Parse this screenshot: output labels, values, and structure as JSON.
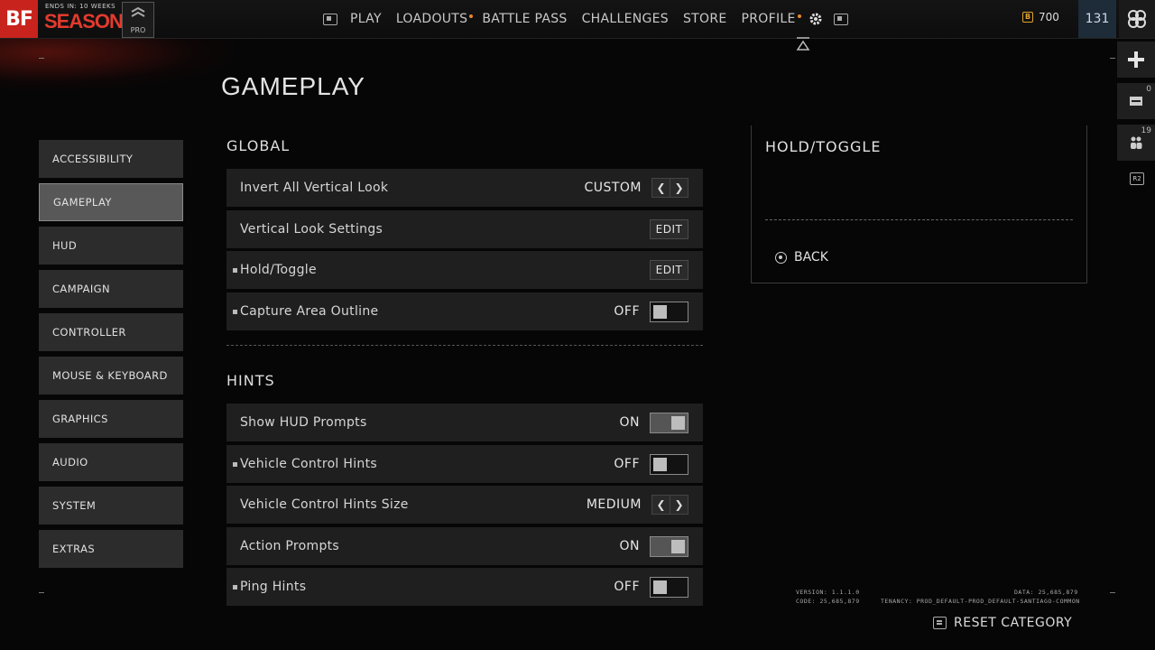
{
  "header": {
    "logo": "BF",
    "season_ends": "ENDS IN: 10 WEEKS",
    "season_title": "SEASON 1",
    "pro_label": "PRO",
    "nav": [
      {
        "label": "PLAY",
        "dot": false
      },
      {
        "label": "LOADOUTS",
        "dot": true
      },
      {
        "label": "BATTLE PASS",
        "dot": false
      },
      {
        "label": "CHALLENGES",
        "dot": false
      },
      {
        "label": "STORE",
        "dot": false
      },
      {
        "label": "PROFILE",
        "dot": true
      }
    ],
    "currency": "700",
    "level": "131",
    "colors": {
      "accent_red": "#c8231d",
      "notification_dot": "#e8882a",
      "currency_gold": "#e0a32e"
    }
  },
  "rail": {
    "invite_count": "0",
    "party_count": "19",
    "r2_label": "R2"
  },
  "page": {
    "title": "GAMEPLAY"
  },
  "sidebar": {
    "items": [
      {
        "label": "ACCESSIBILITY",
        "active": false
      },
      {
        "label": "GAMEPLAY",
        "active": true
      },
      {
        "label": "HUD",
        "active": false
      },
      {
        "label": "CAMPAIGN",
        "active": false
      },
      {
        "label": "CONTROLLER",
        "active": false
      },
      {
        "label": "MOUSE & KEYBOARD",
        "active": false
      },
      {
        "label": "GRAPHICS",
        "active": false
      },
      {
        "label": "AUDIO",
        "active": false
      },
      {
        "label": "SYSTEM",
        "active": false
      },
      {
        "label": "EXTRAS",
        "active": false
      }
    ]
  },
  "global": {
    "heading": "GLOBAL",
    "rows": [
      {
        "label": "Invert All Vertical Look",
        "value": "CUSTOM",
        "control": "arrows",
        "bullet": false
      },
      {
        "label": "Vertical Look Settings",
        "value": "EDIT",
        "control": "edit",
        "bullet": false
      },
      {
        "label": "Hold/Toggle",
        "value": "EDIT",
        "control": "edit",
        "bullet": true
      },
      {
        "label": "Capture Area Outline",
        "value": "OFF",
        "control": "toggle",
        "bullet": true
      }
    ]
  },
  "hints": {
    "heading": "HINTS",
    "rows": [
      {
        "label": "Show HUD Prompts",
        "value": "ON",
        "control": "toggle",
        "bullet": false
      },
      {
        "label": "Vehicle Control Hints",
        "value": "OFF",
        "control": "toggle",
        "bullet": true
      },
      {
        "label": "Vehicle Control Hints Size",
        "value": "MEDIUM",
        "control": "arrows",
        "bullet": false
      },
      {
        "label": "Action Prompts",
        "value": "ON",
        "control": "toggle",
        "bullet": false
      },
      {
        "label": "Ping Hints",
        "value": "OFF",
        "control": "toggle",
        "bullet": true
      }
    ]
  },
  "detail": {
    "title": "HOLD/TOGGLE",
    "back_label": "BACK"
  },
  "footer": {
    "version": "VERSION: 1.1.1.0",
    "code": "CODE: 25,685,879",
    "data": "DATA: 25,685,879",
    "tenancy": "TENANCY: PROD_DEFAULT-PROD_DEFAULT-SANTIAGO-COMMON",
    "reset_label": "RESET CATEGORY"
  }
}
